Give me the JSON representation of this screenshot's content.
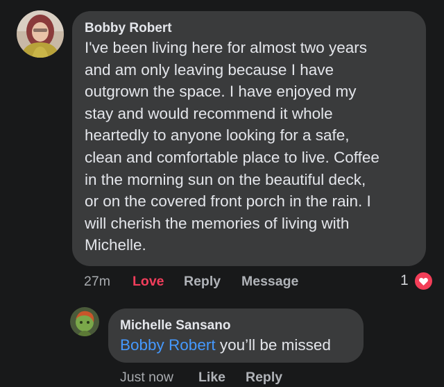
{
  "comment": {
    "author": "Bobby Robert",
    "text": "I've been living here for almost two years\nand am only leaving because I have\noutgrown the space.  I have enjoyed my\nstay and would recommend it whole\nheartedly to anyone looking for a safe,\nclean and comfortable place to live.  Coffee\nin the morning sun on the beautiful deck,\nor on the covered front porch in the rain.  I\nwill cherish the memories of living with\nMichelle.",
    "time": "27m",
    "love_label": "Love",
    "reply_label": "Reply",
    "message_label": "Message",
    "reaction_count": "1",
    "reaction_icon": "heart-icon",
    "colors": {
      "love": "#f23e5c",
      "bubble": "#3a3b3c",
      "background": "#18191a"
    }
  },
  "reply": {
    "author": "Michelle Sansano",
    "mention": "Bobby Robert",
    "text": " you’ll be missed",
    "time": "Just now",
    "like_label": "Like",
    "reply_label": "Reply",
    "colors": {
      "mention": "#4599ff"
    }
  }
}
